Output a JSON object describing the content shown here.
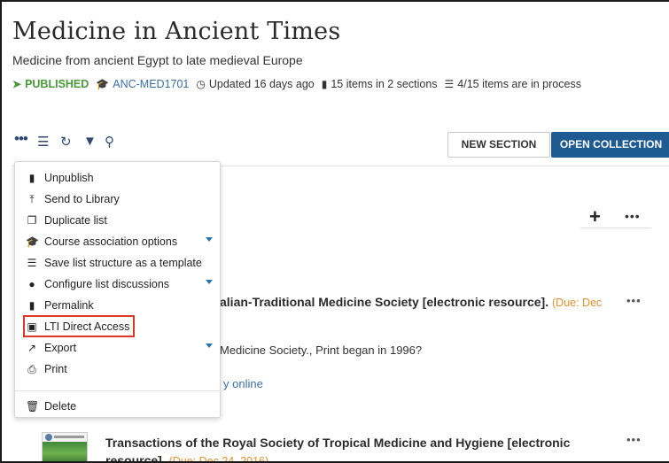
{
  "header": {
    "title": "Medicine in Ancient Times",
    "subtitle": "Medicine from ancient Egypt to late medieval Europe",
    "status": "PUBLISHED",
    "course_code": "ANC-MED1701",
    "updated": "Updated 16 days ago",
    "items_sections": "15 items in 2 sections",
    "in_process": "4/15 items are in process"
  },
  "toolbar": {
    "new_section_label": "NEW SECTION",
    "open_collection_label": "OPEN COLLECTION"
  },
  "menu": {
    "items": [
      {
        "label": "Unpublish",
        "icon": "file-icon"
      },
      {
        "label": "Send to Library",
        "icon": "pin-icon"
      },
      {
        "label": "Duplicate list",
        "icon": "copy-icon"
      },
      {
        "label": "Course association options",
        "icon": "graduation-cap-icon"
      },
      {
        "label": "Save list structure as a template",
        "icon": "list-icon"
      },
      {
        "label": "Configure list discussions",
        "icon": "comments-icon"
      },
      {
        "label": "Permalink",
        "icon": "link-file-icon"
      },
      {
        "label": "LTI Direct Access",
        "icon": "external-link-icon"
      },
      {
        "label": "Export",
        "icon": "export-icon"
      },
      {
        "label": "Print",
        "icon": "print-icon"
      },
      {
        "label": "Delete",
        "icon": "trash-icon"
      }
    ]
  },
  "items": [
    {
      "title_visible": "alian-Traditional Medicine Society [electronic resource].",
      "due": "(Due: Dec",
      "sub_visible": "Medicine Society., Print began in 1996?",
      "link_visible": "y online"
    },
    {
      "title_line1": "Transactions of the Royal Society of Tropical Medicine and Hygiene [electronic",
      "title_line2": "resource].",
      "due": "(Due: Dec 24, 2016)"
    }
  ],
  "colors": {
    "accent_button": "#1f5b93",
    "published_green": "#4a9a3a",
    "due_orange": "#e0922e",
    "highlight_red": "#d9382b"
  }
}
